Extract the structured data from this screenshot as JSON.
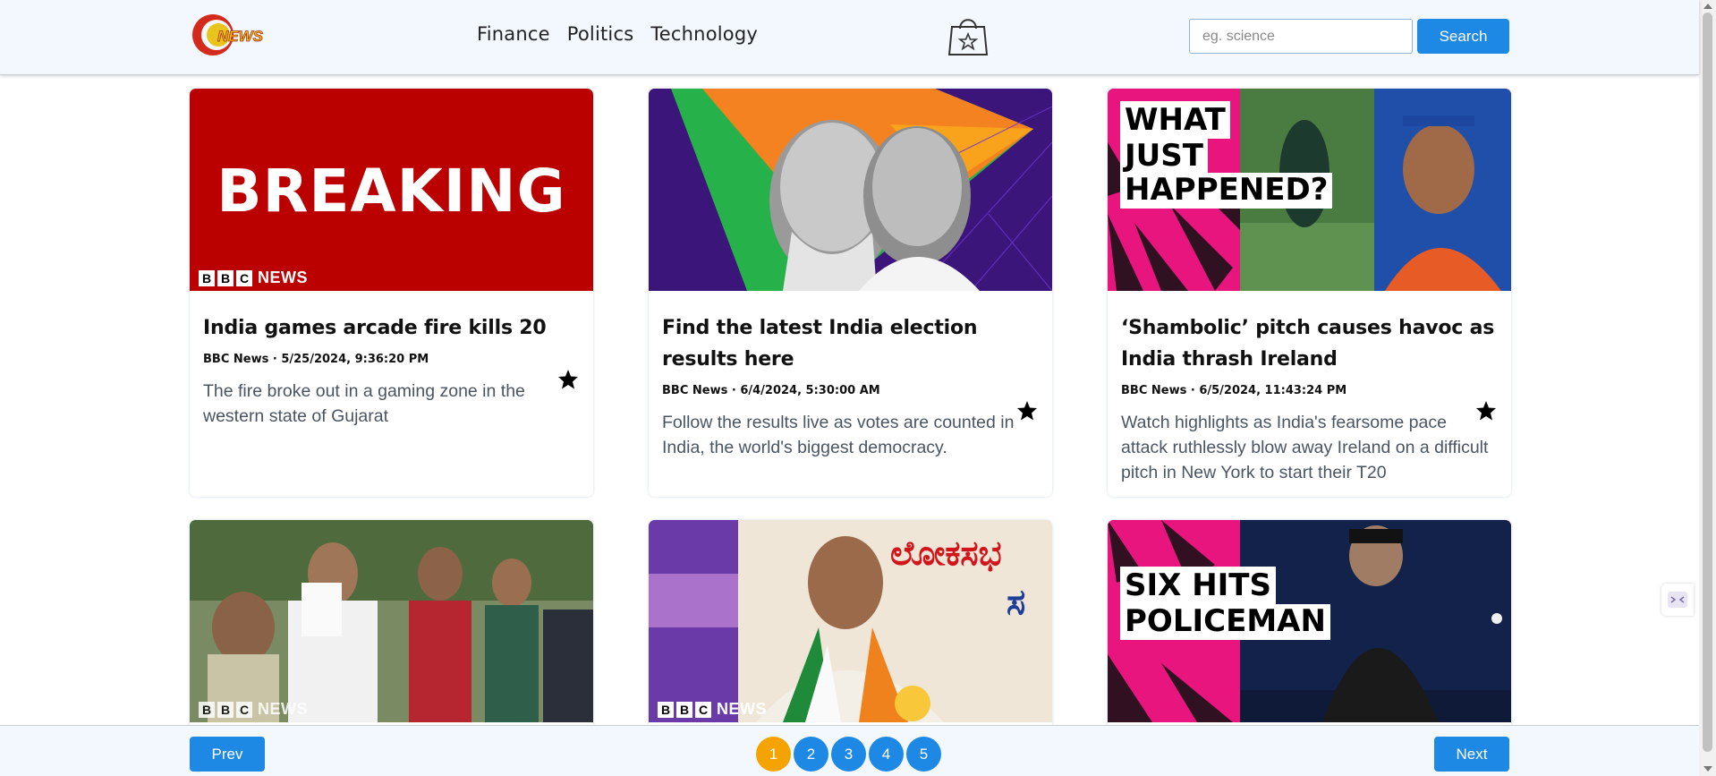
{
  "header": {
    "logo_text": "NEWS",
    "nav": [
      "Finance",
      "Politics",
      "Technology"
    ],
    "search": {
      "placeholder": "eg. science",
      "button_label": "Search"
    }
  },
  "cards": [
    {
      "image_text": "BREAKING",
      "badge": "NEWS",
      "title": "India games arcade fire kills 20",
      "meta": "BBC News · 5/25/2024, 9:36:20 PM",
      "description": "The fire broke out in a gaming zone in the western state of Gujarat"
    },
    {
      "title": "Find the latest India election results here",
      "meta": "BBC News · 6/4/2024, 5:30:00 AM",
      "description": "Follow the results live as votes are counted in India, the world's biggest democracy."
    },
    {
      "image_text": [
        "WHAT",
        "JUST",
        "HAPPENED?"
      ],
      "title": "‘Shambolic’ pitch causes havoc as India thrash Ireland",
      "meta": "BBC News · 6/5/2024, 11:43:24 PM",
      "description": "Watch highlights as India's fearsome pace attack ruthlessly blow away Ireland on a difficult pitch in New York to start their T20"
    },
    {
      "badge": "NEWS"
    },
    {
      "badge": "NEWS"
    },
    {
      "image_text": [
        "SIX HITS",
        "POLICEMAN"
      ]
    }
  ],
  "pagination": {
    "prev_label": "Prev",
    "next_label": "Next",
    "pages": [
      "1",
      "2",
      "3",
      "4",
      "5"
    ],
    "current": "1"
  },
  "colors": {
    "accent": "#1e88e5",
    "active_page": "#f5a300",
    "header_bg": "#f2f8fd"
  }
}
